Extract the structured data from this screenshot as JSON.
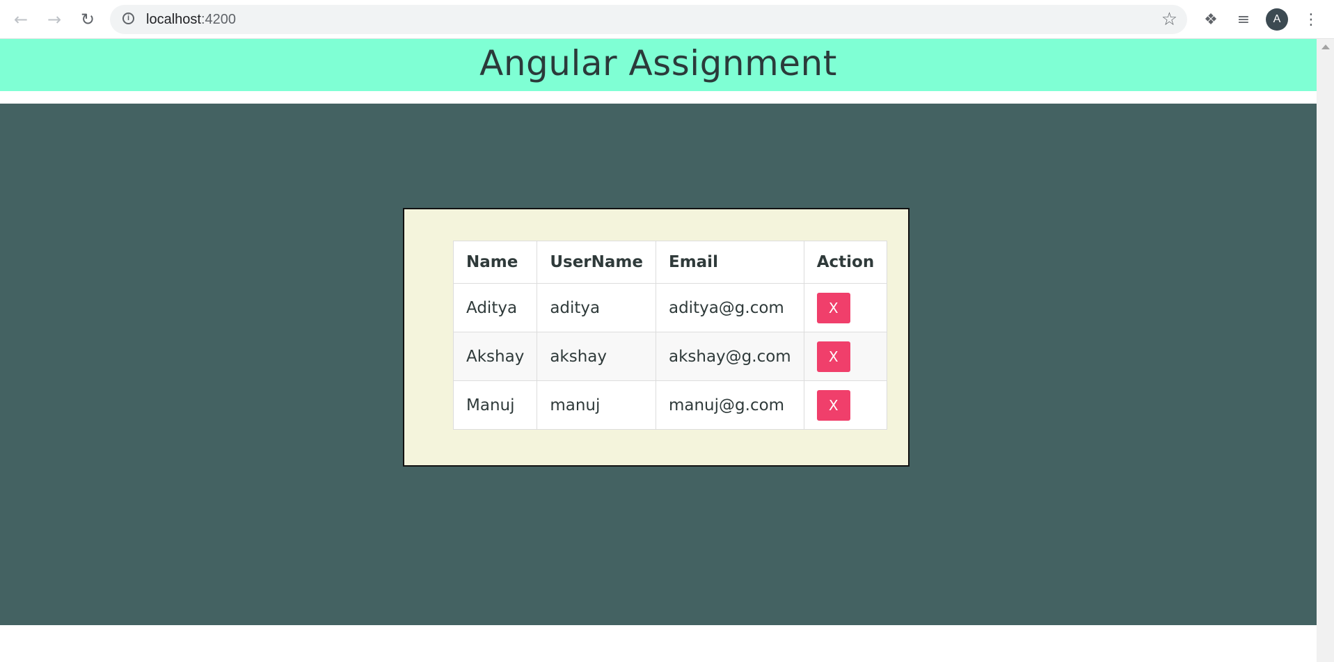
{
  "browser": {
    "url_host": "localhost",
    "url_port": ":4200",
    "profile_initial": "A"
  },
  "header": {
    "title": "Angular Assignment"
  },
  "table": {
    "columns": [
      "Name",
      "UserName",
      "Email",
      "Action"
    ],
    "rows": [
      {
        "name": "Aditya",
        "username": "aditya",
        "email": "aditya@g.com",
        "action_label": "X"
      },
      {
        "name": "Akshay",
        "username": "akshay",
        "email": "akshay@g.com",
        "action_label": "X"
      },
      {
        "name": "Manuj",
        "username": "manuj",
        "email": "manuj@g.com",
        "action_label": "X"
      }
    ]
  },
  "colors": {
    "header_bg": "#7fffd4",
    "main_bg": "#446262",
    "card_bg": "#f4f4dc",
    "delete_button": "#f03f6b"
  },
  "icons": [
    "back-arrow-icon",
    "forward-arrow-icon",
    "reload-icon",
    "site-info-icon",
    "bookmark-star-icon",
    "extensions-icon",
    "media-queue-icon",
    "menu-kebab-icon"
  ]
}
